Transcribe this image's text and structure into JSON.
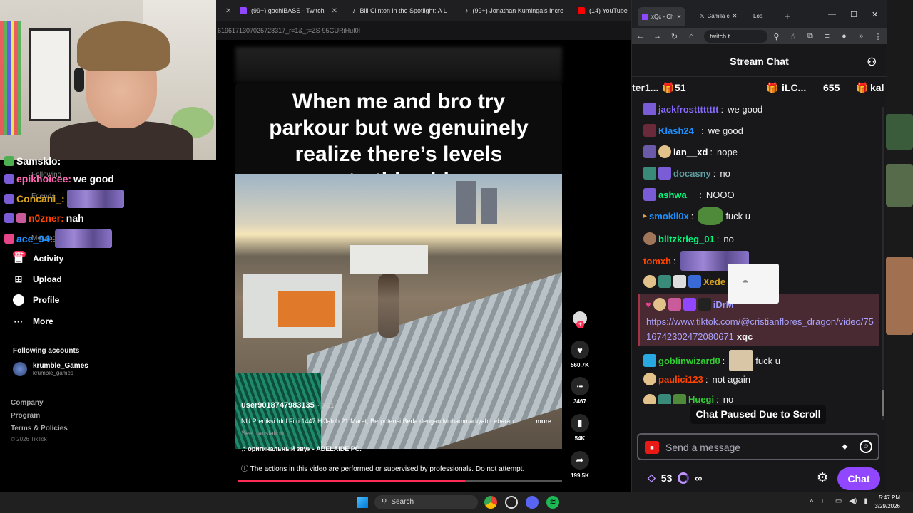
{
  "left_browser": {
    "tabs": [
      {
        "title": "(99+) gachiBASS - Twitch",
        "icon": "twitch-icon",
        "color": "#9147ff"
      },
      {
        "title": "Bill Clinton in the Spotlight: A L",
        "icon": "tiktok-icon",
        "color": "#ffffff"
      },
      {
        "title": "(99+) Jonathan Kuminga's Incre",
        "icon": "tiktok-icon",
        "color": "#ffffff"
      },
      {
        "title": "(14) YouTube",
        "icon": "youtube-icon",
        "color": "#ff0000"
      }
    ],
    "url": "6196171307025728317_r=1&_t=ZS-95GURiHuI0I"
  },
  "stream_overlay_chat": [
    {
      "user": "Samsklo:",
      "text": "",
      "color": "#ffffff"
    },
    {
      "user": "epikhoicee:",
      "text": "we good",
      "color": "#ff69b4"
    },
    {
      "user": "Concani_:",
      "text": "",
      "color": "#daa520"
    },
    {
      "user": "n0zner:",
      "text": "nah",
      "color": "#ff4500"
    },
    {
      "user": "ace_94:",
      "text": "",
      "color": "#1e90ff"
    }
  ],
  "overlay_ghost": {
    "following": "Following",
    "friends": "Friends",
    "messages": "Messages"
  },
  "tiktok_nav": {
    "badge": "99+",
    "items": [
      {
        "label": "Activity",
        "icon": "inbox-icon"
      },
      {
        "label": "Upload",
        "icon": "plus-square-icon"
      },
      {
        "label": "Profile",
        "icon": "avatar-icon"
      },
      {
        "label": "More",
        "icon": "more-dots-icon"
      }
    ],
    "following_title": "Following accounts",
    "following_account": {
      "name": "krumble_Games",
      "handle": "krumble_games"
    },
    "footer": [
      "Company",
      "Program",
      "Terms & Policies"
    ],
    "copyright": "© 2026 TikTok"
  },
  "video": {
    "caption_lines": [
      "When me and bro try",
      "parkour but we genuinely",
      "realize there’s levels",
      "to this shi"
    ],
    "username": "user9018747983135",
    "date": "· 3-21",
    "description": "NU Prediksi Idul Fitri 1447 H Jatuh 21 Maret, Berpotensi Beda dengan Muhammadiyah Lebaran",
    "more": "more",
    "see_translation": "See translation",
    "sound": "♫  оригинальный звук - ADELAIDE PC.",
    "warning": "ⓘ  The actions in this video are performed or supervised by professionals. Do not attempt.",
    "progress": 0.7,
    "actions": [
      {
        "icon": "heart-icon",
        "glyph": "♥",
        "count": "560.7K"
      },
      {
        "icon": "comment-icon",
        "glyph": "•••",
        "count": "3467"
      },
      {
        "icon": "bookmark-icon",
        "glyph": "▮",
        "count": "54K"
      },
      {
        "icon": "share-icon",
        "glyph": "➦",
        "count": "199.5K"
      }
    ]
  },
  "chat_window": {
    "tabs": [
      {
        "title": "xQc - Ch",
        "active": true
      },
      {
        "title": "Camila c"
      },
      {
        "title": "Loa"
      }
    ],
    "url": "twitch.t...",
    "title": "Stream Chat",
    "hype": [
      {
        "text": "ter1...",
        "icon": "gift-icon"
      },
      {
        "text": "51"
      },
      {
        "text": "iLC...",
        "icon": "gift-icon"
      },
      {
        "text": "655"
      },
      {
        "text": "kal",
        "icon": "gift-icon"
      }
    ],
    "messages": [
      {
        "user": "jackfrostttttttt",
        "text": "we good",
        "color": "#8a6cff"
      },
      {
        "user": "Klash24_",
        "text": "we good",
        "color": "#1e90ff"
      },
      {
        "user": "ian__xd",
        "text": "nope",
        "color": "#ffffff"
      },
      {
        "user": "docasny",
        "text": "no",
        "color": "#5f9ea0"
      },
      {
        "user": "ashwa__",
        "text": "NOOO",
        "color": "#00ff7f"
      },
      {
        "user": "smokii0x",
        "text": "fuck u",
        "color": "#1e90ff"
      },
      {
        "user": "blitzkrieg_01",
        "text": "no",
        "color": "#00ff7f"
      },
      {
        "user": "tomxh",
        "text": "",
        "color": "#ff4500"
      },
      {
        "user": "Xede",
        "text": "",
        "color": "#daa520"
      },
      {
        "user": "iDrM",
        "text": "",
        "color": "#9a9aff"
      },
      {
        "user": "goblinwizard0",
        "text": "fuck u",
        "color": "#32cd32"
      },
      {
        "user": "paulici123",
        "text": "not again",
        "color": "#ff4500"
      },
      {
        "user": "Huegi",
        "text": "no",
        "color": "#32cd32"
      }
    ],
    "highlight_link": "https://www.tiktok.com/@cristianflores_dragon/video/7516742302472080671",
    "highlight_mention": "xqc",
    "paused": "Chat Paused Due to Scroll",
    "placeholder": "Send a message",
    "points": "53",
    "infinity": "∞",
    "chat_button": "Chat"
  },
  "taskbar": {
    "search": "Search",
    "time": "5:47 PM",
    "date": "3/29/2026"
  }
}
